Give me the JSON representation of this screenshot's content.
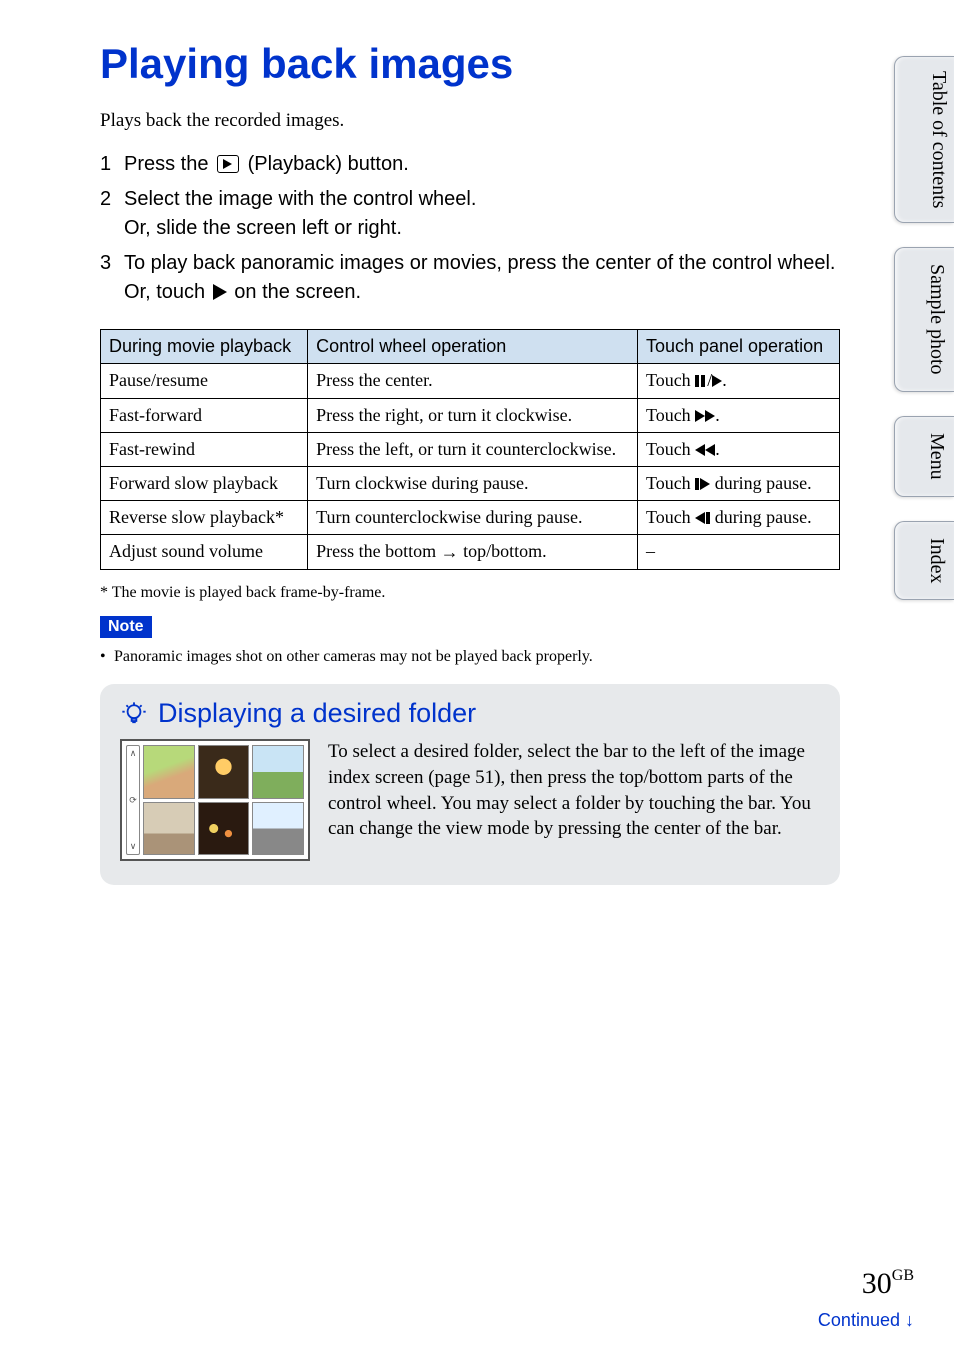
{
  "title": "Playing back images",
  "intro": "Plays back the recorded images.",
  "steps": [
    {
      "num": "1",
      "pre": "Press the ",
      "icon": "playback-box",
      "post": " (Playback) button."
    },
    {
      "num": "2",
      "pre": "Select the image with the control wheel.",
      "sub": "Or, slide the screen left or right."
    },
    {
      "num": "3",
      "pre": "To play back panoramic images or movies, press the center of the control wheel.",
      "sub_pre": "Or, touch ",
      "sub_icon": "play-solid",
      "sub_post": " on the screen."
    }
  ],
  "table": {
    "headers": [
      "During movie playback",
      "Control wheel operation",
      "Touch panel operation"
    ],
    "rows": [
      {
        "c0": "Pause/resume",
        "c1": "Press the center.",
        "c2_pre": "Touch ",
        "c2_icon": "pause-play",
        "c2_post": "."
      },
      {
        "c0": "Fast-forward",
        "c1": "Press the right, or turn it clockwise.",
        "c2_pre": "Touch ",
        "c2_icon": "ff",
        "c2_post": "."
      },
      {
        "c0": "Fast-rewind",
        "c1": "Press the left, or turn it counterclockwise.",
        "c2_pre": "Touch ",
        "c2_icon": "rw",
        "c2_post": "."
      },
      {
        "c0": "Forward slow playback",
        "c1": "Turn clockwise during pause.",
        "c2_pre": "Touch ",
        "c2_icon": "step-fwd",
        "c2_post": " during pause."
      },
      {
        "c0": "Reverse slow playback*",
        "c1": "Turn counterclockwise during pause.",
        "c2_pre": "Touch ",
        "c2_icon": "step-rev",
        "c2_post": " during pause."
      },
      {
        "c0": "Adjust sound volume",
        "c1_pre": "Press the bottom ",
        "c1_icon": "arrow",
        "c1_post": " top/bottom.",
        "c2_pre": "–"
      }
    ]
  },
  "footnote": "*   The movie is played back frame-by-frame.",
  "note_label": "Note",
  "note_item": "Panoramic images shot on other cameras may not be played back properly.",
  "tip": {
    "title": "Displaying a desired folder",
    "text": "To select a desired folder, select the bar to the left of the image index screen (page 51), then press the top/bottom parts of the control wheel. You may select a folder by touching the bar. You can change the view mode by pressing the center of the bar."
  },
  "tabs": [
    "Table of contents",
    "Sample photo",
    "Menu",
    "Index"
  ],
  "page_number": "30",
  "page_suffix": "GB",
  "continued": "Continued ↓"
}
